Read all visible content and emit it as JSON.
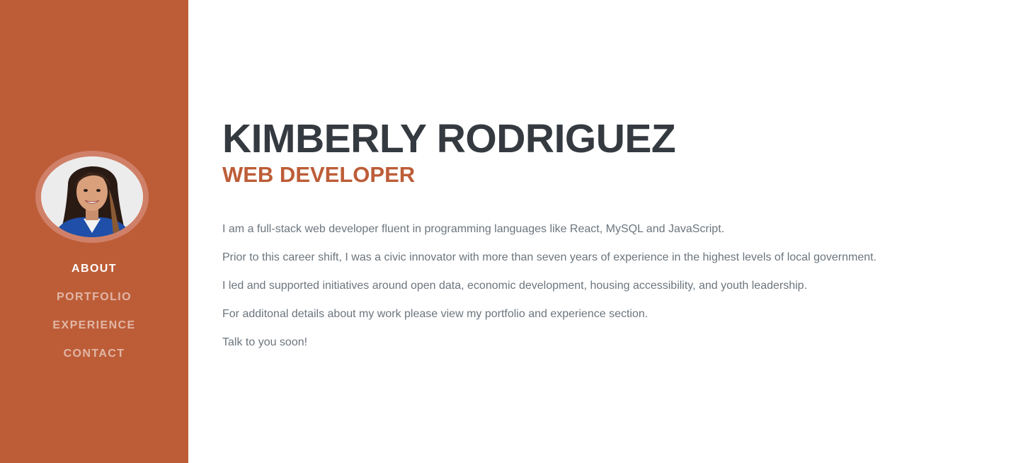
{
  "profile": {
    "name": "KIMBERLY RODRIGUEZ",
    "title": "WEB DEVELOPER",
    "avatar_alt": "profile photo"
  },
  "sidebar": {
    "nav": [
      {
        "label": "ABOUT",
        "active": true
      },
      {
        "label": "PORTFOLIO",
        "active": false
      },
      {
        "label": "EXPERIENCE",
        "active": false
      },
      {
        "label": "CONTACT",
        "active": false
      }
    ]
  },
  "about": {
    "paragraphs": [
      "I am a full-stack web developer fluent in programming languages like React, MySQL and JavaScript.",
      "Prior to this career shift, I was a civic innovator with more than seven years of experience in the highest levels of local government.",
      "I led and supported initiatives around open data, economic development, housing accessibility, and youth leadership.",
      "For additonal details about my work please view my portfolio and experience section.",
      "Talk to you soon!"
    ]
  },
  "colors": {
    "primary": "#bd5d38",
    "heading": "#343a40",
    "body_text": "#6c757d",
    "avatar_ring": "#d08068"
  }
}
